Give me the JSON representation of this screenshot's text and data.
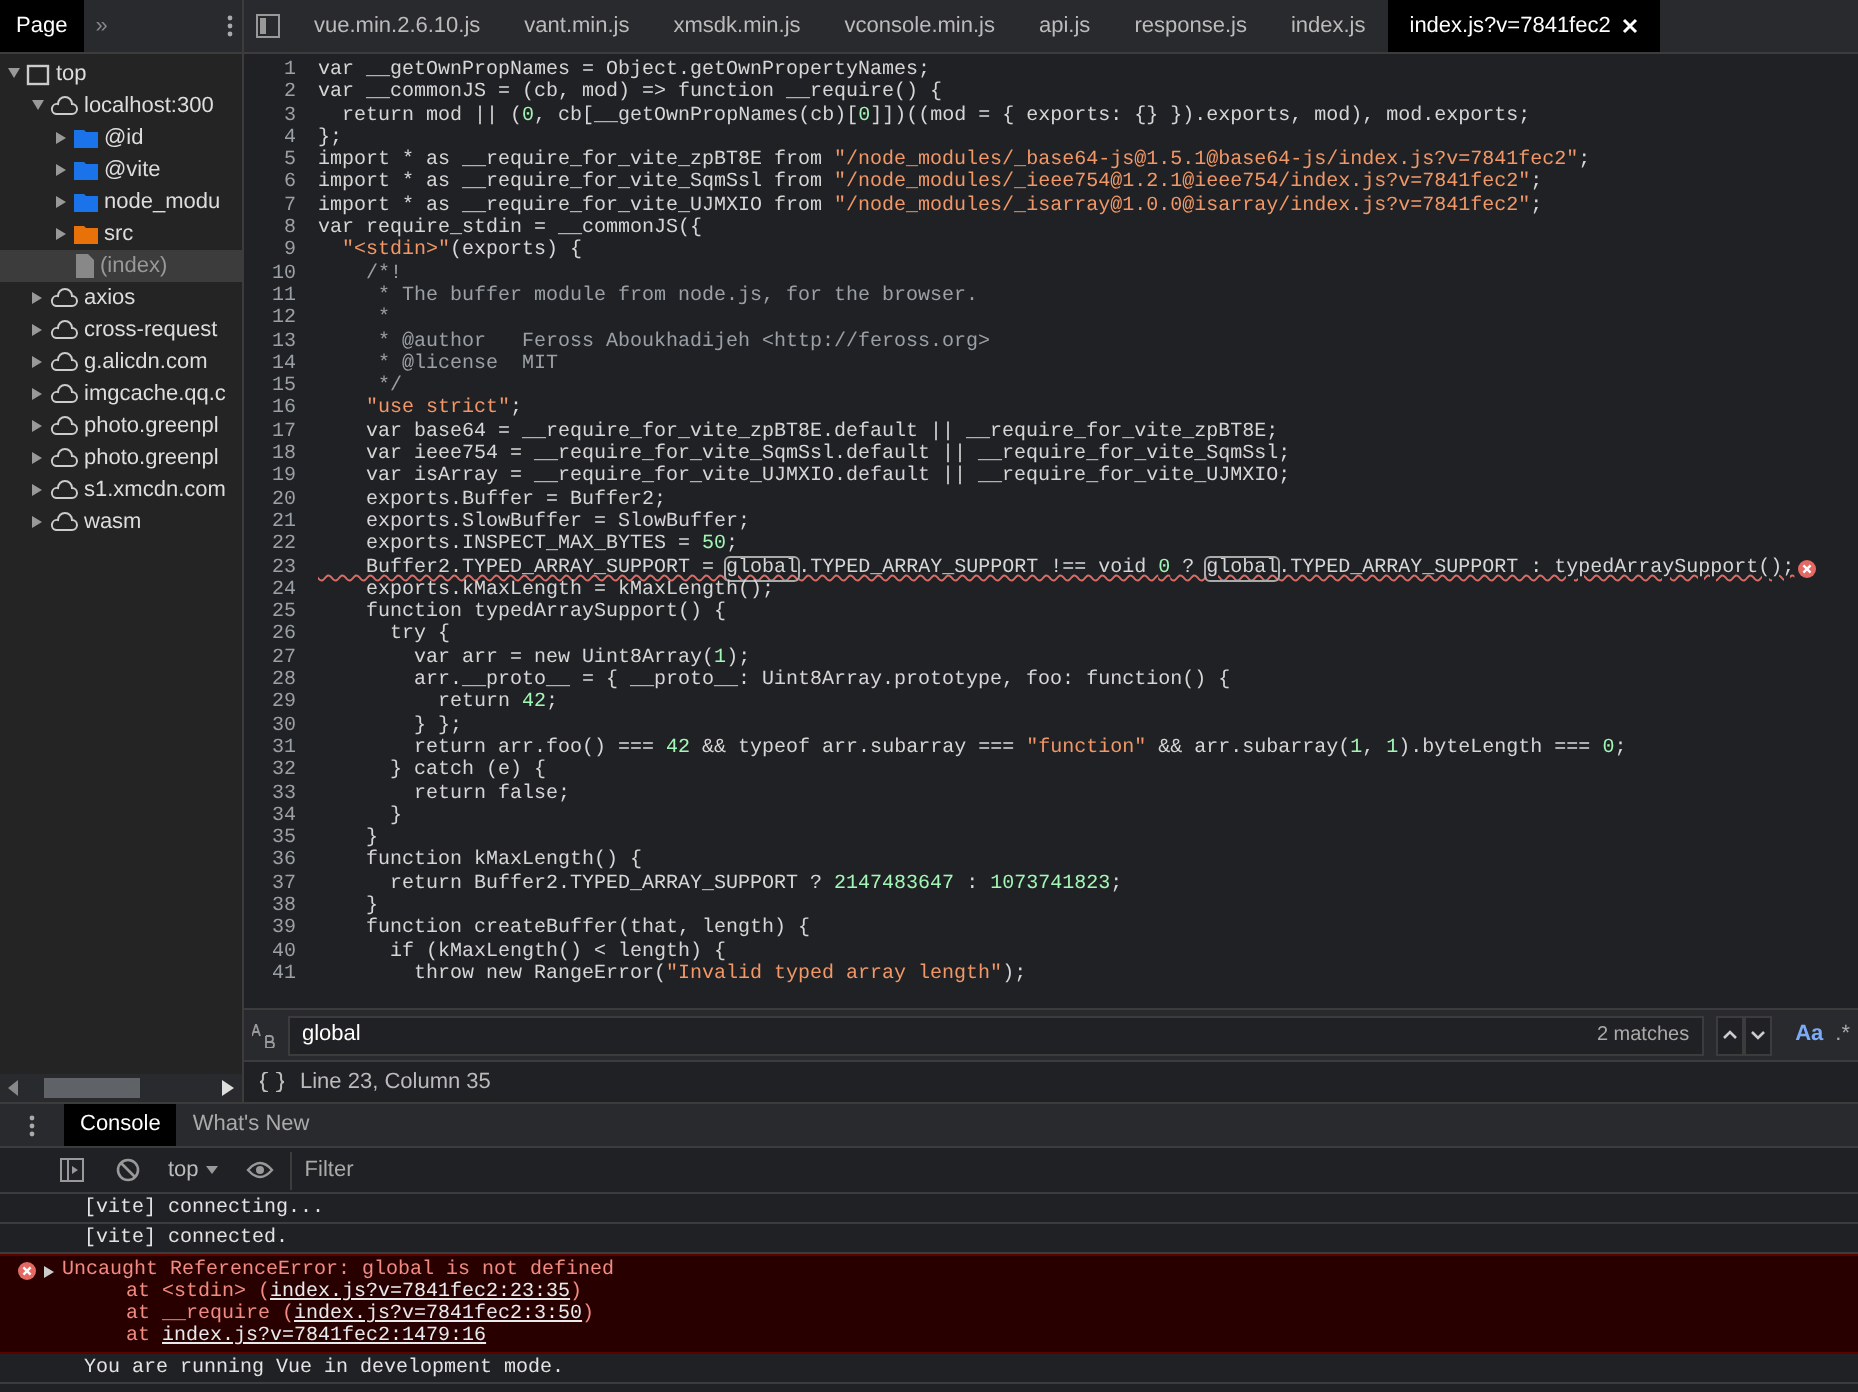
{
  "navigator": {
    "tabs": [
      {
        "label": "Page",
        "selected": true
      }
    ],
    "more": "»",
    "tree": [
      {
        "label": "top",
        "kind": "frame",
        "expanded": true,
        "children": [
          {
            "label": "localhost:300",
            "kind": "cloud",
            "expanded": true,
            "children": [
              {
                "label": "@id",
                "kind": "folder",
                "color": "#1a73e8",
                "expanded": false
              },
              {
                "label": "@vite",
                "kind": "folder",
                "color": "#1a73e8",
                "expanded": false
              },
              {
                "label": "node_modu",
                "kind": "folder",
                "color": "#1a73e8",
                "expanded": false
              },
              {
                "label": "src",
                "kind": "folder",
                "color": "#e8710a",
                "expanded": false
              },
              {
                "label": "(index)",
                "kind": "file",
                "selected": true
              }
            ]
          },
          {
            "label": "axios",
            "kind": "cloud",
            "expanded": false
          },
          {
            "label": "cross-request",
            "kind": "cloud",
            "expanded": false
          },
          {
            "label": "g.alicdn.com",
            "kind": "cloud",
            "expanded": false
          },
          {
            "label": "imgcache.qq.c",
            "kind": "cloud",
            "expanded": false
          },
          {
            "label": "photo.greenpl",
            "kind": "cloud",
            "expanded": false
          },
          {
            "label": "photo.greenpl",
            "kind": "cloud",
            "expanded": false
          },
          {
            "label": "s1.xmcdn.com",
            "kind": "cloud",
            "expanded": false
          },
          {
            "label": "wasm",
            "kind": "cloud",
            "expanded": false
          }
        ]
      }
    ]
  },
  "editor": {
    "tabs": [
      {
        "label": "vue.min.2.6.10.js",
        "selected": false
      },
      {
        "label": "vant.min.js",
        "selected": false
      },
      {
        "label": "xmsdk.min.js",
        "selected": false
      },
      {
        "label": "vconsole.min.js",
        "selected": false
      },
      {
        "label": "api.js",
        "selected": false
      },
      {
        "label": "response.js",
        "selected": false
      },
      {
        "label": "index.js",
        "selected": false
      },
      {
        "label": "index.js?v=7841fec2",
        "selected": true
      }
    ],
    "lines": [
      {
        "number": "1",
        "text": "var __getOwnPropNames = Object.getOwnPropertyNames;"
      },
      {
        "number": "2",
        "text": "var __commonJS = (cb, mod) => function __require() {"
      },
      {
        "number": "3",
        "text": "  return mod || (0, cb[__getOwnPropNames(cb)[0]])((mod = { exports: {} }).exports, mod), mod.exports;"
      },
      {
        "number": "4",
        "text": "};"
      },
      {
        "number": "5",
        "text": "import * as __require_for_vite_zpBT8E from \"/node_modules/_base64-js@1.5.1@base64-js/index.js?v=7841fec2\";"
      },
      {
        "number": "6",
        "text": "import * as __require_for_vite_SqmSsl from \"/node_modules/_ieee754@1.2.1@ieee754/index.js?v=7841fec2\";"
      },
      {
        "number": "7",
        "text": "import * as __require_for_vite_UJMXIO from \"/node_modules/_isarray@1.0.0@isarray/index.js?v=7841fec2\";"
      },
      {
        "number": "8",
        "text": "var require_stdin = __commonJS({"
      },
      {
        "number": "9",
        "text": "  \"<stdin>\"(exports) {"
      },
      {
        "number": "10",
        "text": "    /*!"
      },
      {
        "number": "11",
        "text": "     * The buffer module from node.js, for the browser."
      },
      {
        "number": "12",
        "text": "     *"
      },
      {
        "number": "13",
        "text": "     * @author   Feross Aboukhadijeh <http://feross.org>"
      },
      {
        "number": "14",
        "text": "     * @license  MIT"
      },
      {
        "number": "15",
        "text": "     */"
      },
      {
        "number": "16",
        "text": "    \"use strict\";"
      },
      {
        "number": "17",
        "text": "    var base64 = __require_for_vite_zpBT8E.default || __require_for_vite_zpBT8E;"
      },
      {
        "number": "18",
        "text": "    var ieee754 = __require_for_vite_SqmSsl.default || __require_for_vite_SqmSsl;"
      },
      {
        "number": "19",
        "text": "    var isArray = __require_for_vite_UJMXIO.default || __require_for_vite_UJMXIO;"
      },
      {
        "number": "20",
        "text": "    exports.Buffer = Buffer2;"
      },
      {
        "number": "21",
        "text": "    exports.SlowBuffer = SlowBuffer;"
      },
      {
        "number": "22",
        "text": "    exports.INSPECT_MAX_BYTES = 50;"
      },
      {
        "number": "23",
        "text": "    Buffer2.TYPED_ARRAY_SUPPORT = global.TYPED_ARRAY_SUPPORT !== void 0 ? global.TYPED_ARRAY_SUPPORT : typedArraySupport();",
        "error": true
      },
      {
        "number": "24",
        "text": "    exports.kMaxLength = kMaxLength();"
      },
      {
        "number": "25",
        "text": "    function typedArraySupport() {"
      },
      {
        "number": "26",
        "text": "      try {"
      },
      {
        "number": "27",
        "text": "        var arr = new Uint8Array(1);"
      },
      {
        "number": "28",
        "text": "        arr.__proto__ = { __proto__: Uint8Array.prototype, foo: function() {"
      },
      {
        "number": "29",
        "text": "          return 42;"
      },
      {
        "number": "30",
        "text": "        } };"
      },
      {
        "number": "31",
        "text": "        return arr.foo() === 42 && typeof arr.subarray === \"function\" && arr.subarray(1, 1).byteLength === 0;"
      },
      {
        "number": "32",
        "text": "      } catch (e) {"
      },
      {
        "number": "33",
        "text": "        return false;"
      },
      {
        "number": "34",
        "text": "      }"
      },
      {
        "number": "35",
        "text": "    }"
      },
      {
        "number": "36",
        "text": "    function kMaxLength() {"
      },
      {
        "number": "37",
        "text": "      return Buffer2.TYPED_ARRAY_SUPPORT ? 2147483647 : 1073741823;"
      },
      {
        "number": "38",
        "text": "    }"
      },
      {
        "number": "39",
        "text": "    function createBuffer(that, length) {"
      },
      {
        "number": "40",
        "text": "      if (kMaxLength() < length) {"
      },
      {
        "number": "41",
        "text": "        throw new RangeError(\"Invalid typed array length\");"
      }
    ],
    "search": {
      "value": "global",
      "matches": "2 matches",
      "case_toggle": "Aa",
      "regex_toggle": ".*"
    },
    "status": "Line 23, Column 35"
  },
  "drawer": {
    "tabs": [
      {
        "label": "Console",
        "selected": true
      },
      {
        "label": "What's New",
        "selected": false
      }
    ],
    "context": "top",
    "filter_placeholder": "Filter",
    "messages": [
      {
        "kind": "log",
        "text": "[vite] connecting..."
      },
      {
        "kind": "log",
        "text": "[vite] connected."
      },
      {
        "kind": "error",
        "text": "Uncaught ReferenceError: global is not defined",
        "expanded": true,
        "stack": [
          {
            "prefix": "at <stdin> (",
            "link": "index.js?v=7841fec2:23:35",
            "suffix": ")"
          },
          {
            "prefix": "at __require (",
            "link": "index.js?v=7841fec2:3:50",
            "suffix": ")"
          },
          {
            "prefix": "at ",
            "link": "index.js?v=7841fec2:1479:16"
          }
        ]
      },
      {
        "kind": "log",
        "text": "You are running Vue in development mode."
      }
    ]
  }
}
